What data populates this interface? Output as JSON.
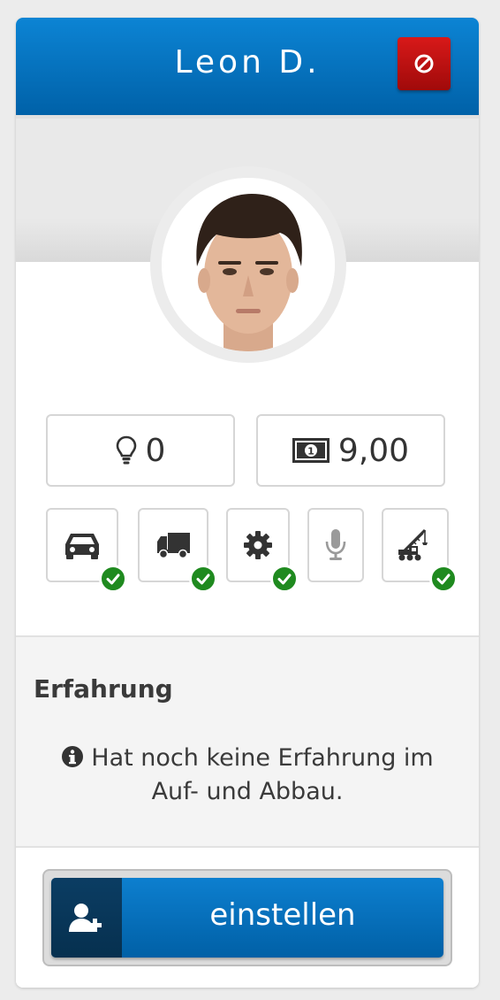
{
  "header": {
    "name": "Leon D.",
    "remove_icon": "ban-icon"
  },
  "avatar": {
    "icon": "person-portrait"
  },
  "stats": [
    {
      "icon": "lightbulb-icon",
      "value": "0"
    },
    {
      "icon": "money-icon",
      "value": "9,00"
    }
  ],
  "skills": [
    {
      "icon": "car-icon",
      "verified": true
    },
    {
      "icon": "truck-icon",
      "verified": true
    },
    {
      "icon": "gear-icon",
      "verified": true
    },
    {
      "icon": "microphone-icon",
      "verified": false
    },
    {
      "icon": "crane-icon",
      "verified": true
    }
  ],
  "experience": {
    "title": "Erfahrung",
    "text": "Hat noch keine Erfahrung im Auf- und Abbau."
  },
  "actions": {
    "hire_label": "einstellen",
    "hire_icon": "add-user-icon"
  },
  "colors": {
    "primary": "#0a74c4",
    "danger": "#c41010",
    "success": "#1f8a1f"
  }
}
